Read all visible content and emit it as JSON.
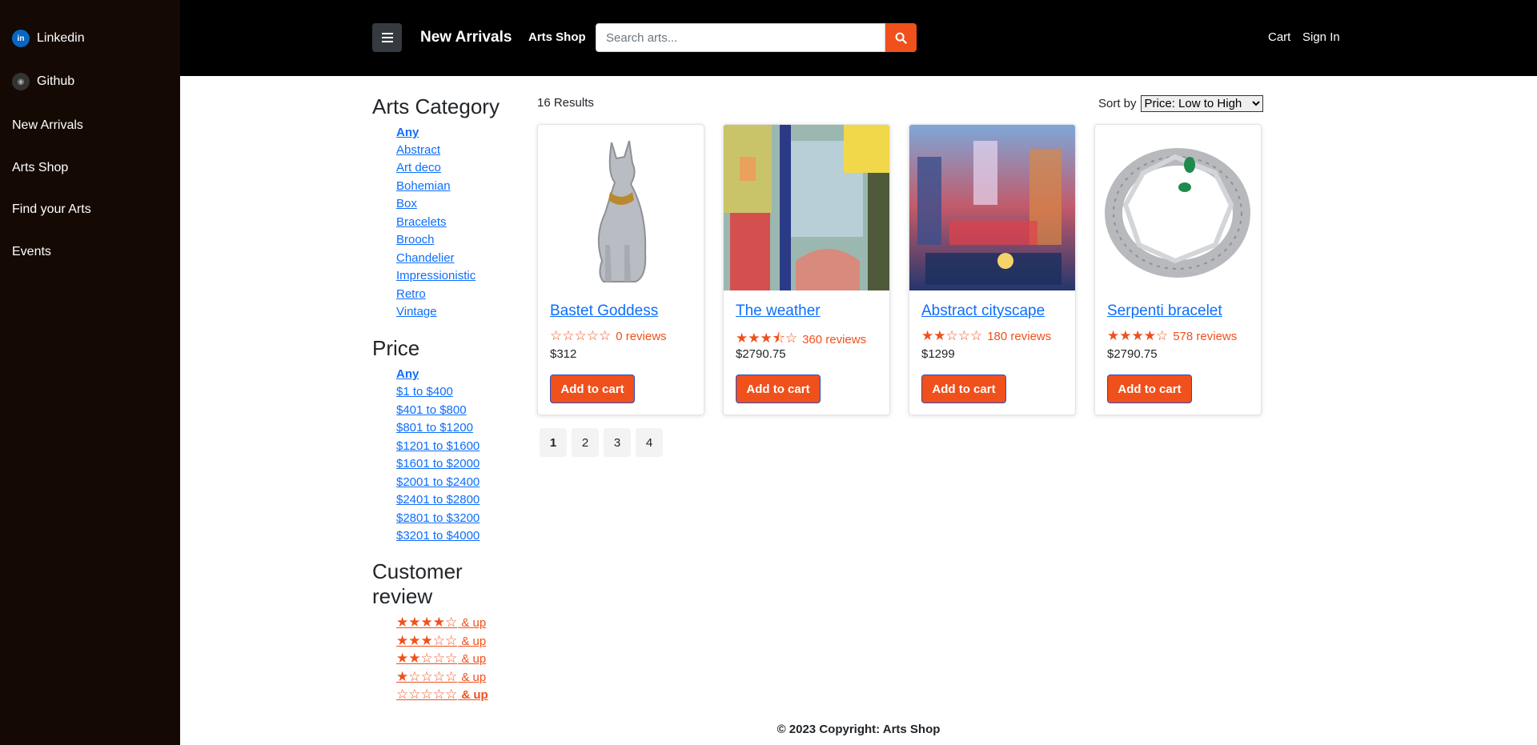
{
  "sidebar": {
    "items": [
      {
        "label": "Linkedin",
        "icon": "linkedin-icon"
      },
      {
        "label": "Github",
        "icon": "github-icon"
      },
      {
        "label": "New Arrivals"
      },
      {
        "label": "Arts Shop"
      },
      {
        "label": "Find your Arts"
      },
      {
        "label": "Events"
      }
    ]
  },
  "header": {
    "brand": "New Arrivals",
    "shop_link": "Arts Shop",
    "search_placeholder": "Search arts...",
    "cart": "Cart",
    "sign_in": "Sign In"
  },
  "filters": {
    "category_title": "Arts Category",
    "categories": [
      "Any",
      "Abstract",
      "Art deco",
      "Bohemian",
      "Box",
      "Bracelets",
      "Brooch",
      "Chandelier",
      "Impressionistic",
      "Retro",
      "Vintage"
    ],
    "price_title": "Price",
    "prices": [
      "Any",
      "$1 to $400",
      "$401 to $800",
      "$801 to $1200",
      "$1201 to $1600",
      "$1601 to $2000",
      "$2001 to $2400",
      "$2401 to $2800",
      "$2801 to $3200",
      "$3201 to $4000"
    ],
    "review_title_line1": "Customer",
    "review_title_line2": "review",
    "review_suffix": " & up",
    "review_levels": [
      4,
      3,
      2,
      1,
      0
    ]
  },
  "results": {
    "count_text": "16 Results",
    "sort_label": "Sort by",
    "sort_value": "Price: Low to High"
  },
  "products": [
    {
      "name": "Bastet Goddess",
      "rating": 0,
      "reviews": "0 reviews",
      "price": "$312",
      "button": "Add to cart"
    },
    {
      "name": "The weather",
      "rating": 3.5,
      "reviews": "360 reviews",
      "price": "$2790.75",
      "button": "Add to cart"
    },
    {
      "name": "Abstract cityscape",
      "rating": 2,
      "reviews": "180 reviews",
      "price": "$1299",
      "button": "Add to cart"
    },
    {
      "name": "Serpenti bracelet",
      "rating": 4,
      "reviews": "578 reviews",
      "price": "$2790.75",
      "button": "Add to cart"
    }
  ],
  "pagination": [
    "1",
    "2",
    "3",
    "4"
  ],
  "footer": "© 2023 Copyright: Arts Shop",
  "colors": {
    "accent": "#f0501c",
    "link": "#0d6efd",
    "sidebar_bg": "#140a03",
    "topbar_bg": "#000000"
  }
}
